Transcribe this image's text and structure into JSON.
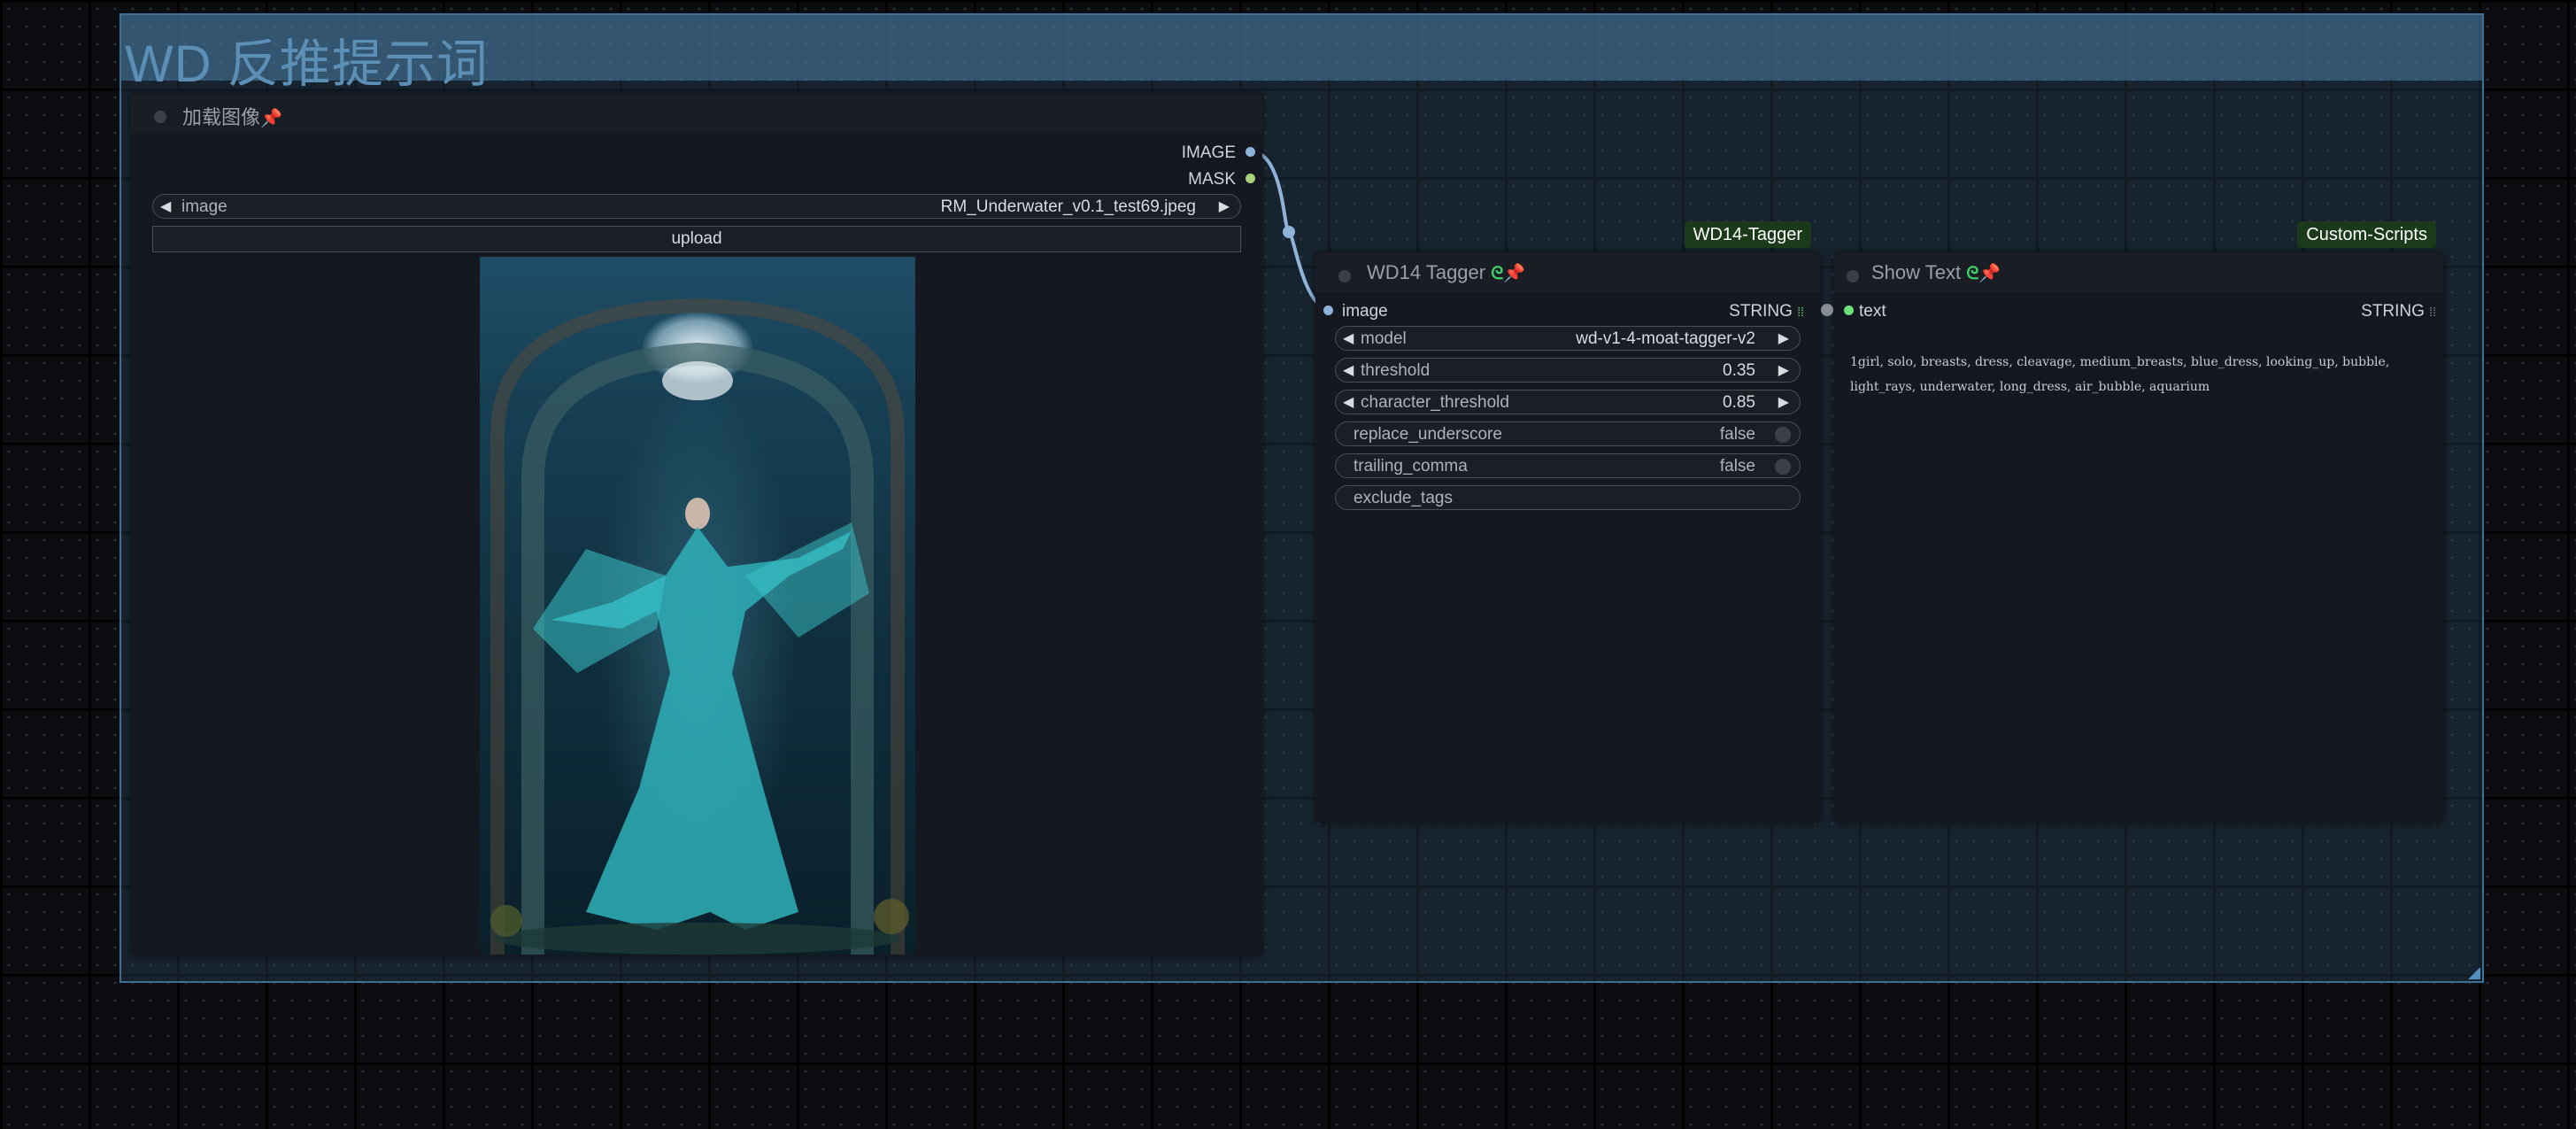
{
  "group": {
    "title": "WD 反推提示词"
  },
  "load_image_node": {
    "title": "加载图像",
    "outputs": [
      "IMAGE",
      "MASK"
    ],
    "image_widget": {
      "label": "image",
      "value": "RM_Underwater_v0.1_test69.jpeg"
    },
    "upload_label": "upload"
  },
  "wd14_node": {
    "title": "WD14 Tagger",
    "badge": "WD14-Tagger",
    "input_label": "image",
    "output_label": "STRING",
    "widgets": {
      "model": {
        "label": "model",
        "value": "wd-v1-4-moat-tagger-v2"
      },
      "threshold": {
        "label": "threshold",
        "value": "0.35"
      },
      "character_threshold": {
        "label": "character_threshold",
        "value": "0.85"
      },
      "replace_underscore": {
        "label": "replace_underscore",
        "value": "false"
      },
      "trailing_comma": {
        "label": "trailing_comma",
        "value": "false"
      },
      "exclude_tags": {
        "label": "exclude_tags"
      }
    }
  },
  "show_text_node": {
    "title": "Show Text",
    "badge": "Custom-Scripts",
    "input_label": "text",
    "output_label": "STRING",
    "text_line1": "1girl, solo, breasts, dress, cleavage, medium_breasts, blue_dress, looking_up, bubble,",
    "text_line2": "light_rays, underwater, long_dress, air_bubble, aquarium"
  },
  "colors": {
    "image_slot": "#8fb3d8",
    "mask_slot": "#a6d07a",
    "string_slot": "#6ee07a",
    "link": "#8fb3d8",
    "badge_bg": "#1a3a1a"
  },
  "icons": [
    "pin-icon",
    "link-icon",
    "grid-icon",
    "arrow-left-icon",
    "arrow-right-icon"
  ]
}
